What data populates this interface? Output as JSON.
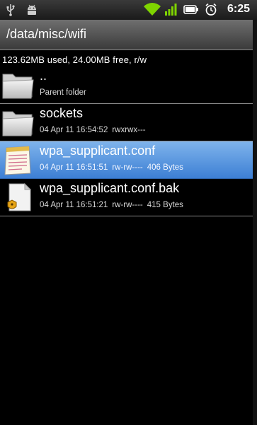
{
  "status": {
    "time": "6:25"
  },
  "path": "/data/misc/wifi",
  "storage_info": "123.62MB used, 24.00MB free, r/w",
  "files": [
    {
      "name": "..",
      "date": "",
      "perms": "",
      "size": "",
      "subtitle": "Parent folder",
      "icon": "folder-icon"
    },
    {
      "name": "sockets",
      "date": "04 Apr 11 16:54:52",
      "perms": "rwxrwx---",
      "size": "",
      "icon": "folder-icon"
    },
    {
      "name": "wpa_supplicant.conf",
      "date": "04 Apr 11 16:51:51",
      "perms": "rw-rw----",
      "size": "406 Bytes",
      "icon": "text-file-icon"
    },
    {
      "name": "wpa_supplicant.conf.bak",
      "date": "04 Apr 11 16:51:21",
      "perms": "rw-rw----",
      "size": "415 Bytes",
      "icon": "locked-file-icon"
    }
  ]
}
